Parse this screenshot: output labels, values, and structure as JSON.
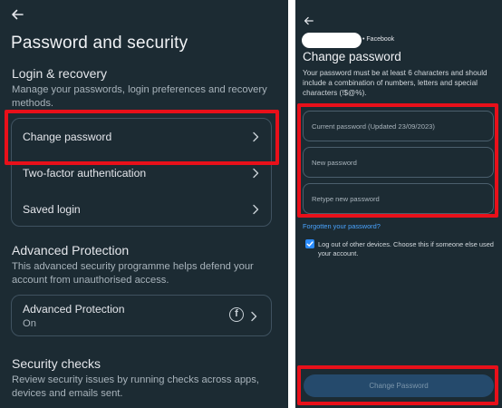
{
  "left": {
    "back_icon": "back-arrow-icon",
    "title": "Password and security",
    "login_recovery": {
      "heading": "Login & recovery",
      "description": "Manage your passwords, login preferences and recovery methods.",
      "items": [
        {
          "label": "Change password",
          "icon": "chevron-right-icon"
        },
        {
          "label": "Two-factor authentication",
          "icon": "chevron-right-icon"
        },
        {
          "label": "Saved login",
          "icon": "chevron-right-icon"
        }
      ]
    },
    "advanced": {
      "heading": "Advanced Protection",
      "description": "This advanced security programme helps defend your account from unauthorised access.",
      "item_label": "Advanced Protection",
      "item_status": "On",
      "item_icon": "facebook-icon",
      "item_icon_glyph": "f"
    },
    "checks": {
      "heading": "Security checks",
      "description": "Review security issues by running checks across apps, devices and emails sent."
    }
  },
  "right": {
    "back_icon": "back-arrow-icon",
    "account_suffix": "• Facebook",
    "title": "Change password",
    "description": "Your password must be at least 6 characters and should include a combination of numbers, letters and special characters (!$@%).",
    "fields": [
      {
        "placeholder": "Current password (Updated 23/09/2023)"
      },
      {
        "placeholder": "New password"
      },
      {
        "placeholder": "Retype new password"
      }
    ],
    "forgot_link": "Forgotten your password?",
    "logout_checkbox": {
      "checked": true,
      "label": "Log out of other devices. Choose this if someone else used your account."
    },
    "submit_label": "Change Password"
  },
  "colors": {
    "background": "#1c2b33",
    "highlight": "#e8101a",
    "link": "#4aa4ff",
    "checkbox": "#2a8cff",
    "button": "#254a6c"
  }
}
